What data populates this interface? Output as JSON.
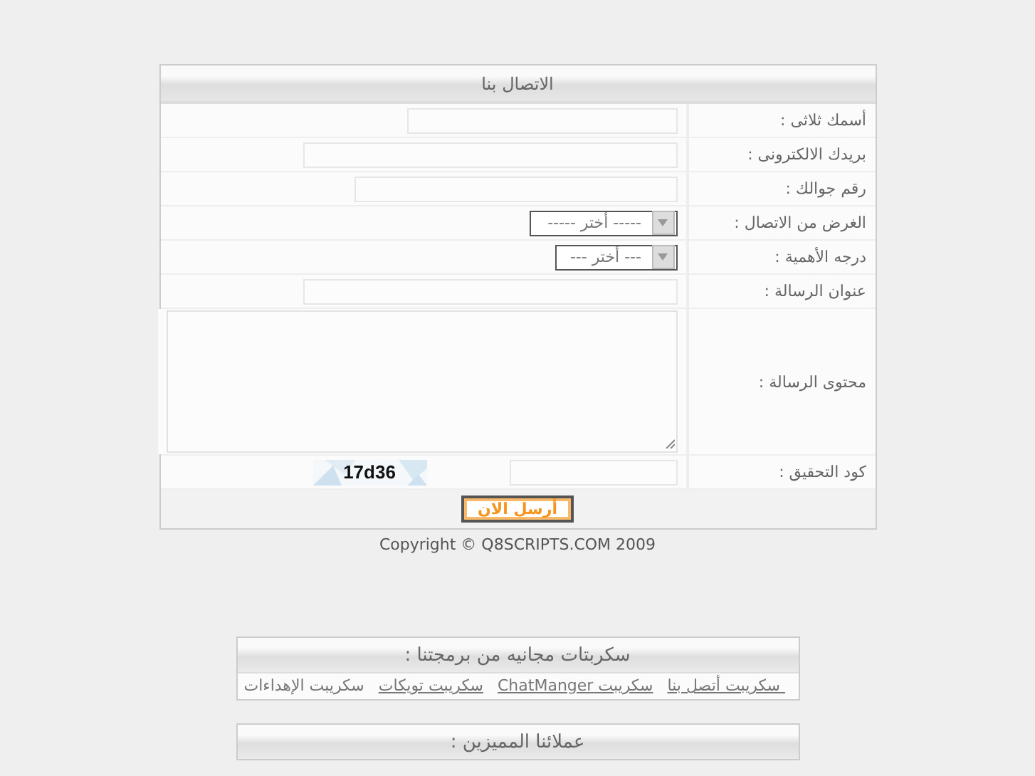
{
  "form": {
    "title": "الاتصال بنا",
    "rows": [
      {
        "label": "أسمك ثلاثى :",
        "kind": "text"
      },
      {
        "label": "بريدك الالكترونى :",
        "kind": "text"
      },
      {
        "label": "رقم جوالك :",
        "kind": "text"
      },
      {
        "label": "الغرض من الاتصال :",
        "kind": "select",
        "value": "----- أختر -----"
      },
      {
        "label": "درجه الأهمية :",
        "kind": "select",
        "value": "--- أختر ---"
      },
      {
        "label": "عنوان الرسالة :",
        "kind": "text"
      },
      {
        "label": "محتوى الرسالة :",
        "kind": "textarea"
      },
      {
        "label": "كود التحقيق :",
        "kind": "captcha",
        "code": "17d36"
      }
    ],
    "submit": "أرسل الان"
  },
  "copyright": "Copyright © Q8SCRIPTS.COM 2009",
  "scripts_box": {
    "title": "سكربتات مجانيه من برمجتنا :",
    "links": [
      {
        "label": " سكريبت أتصل بنا",
        "link": true
      },
      {
        "label": "سكريبت ChatManger",
        "link": true
      },
      {
        "label": "سكريبت تويكات",
        "link": true
      },
      {
        "label": "سكريبت الإهداءات",
        "link": false
      }
    ]
  },
  "clients_box": {
    "title": "عملائنا المميزين :"
  }
}
